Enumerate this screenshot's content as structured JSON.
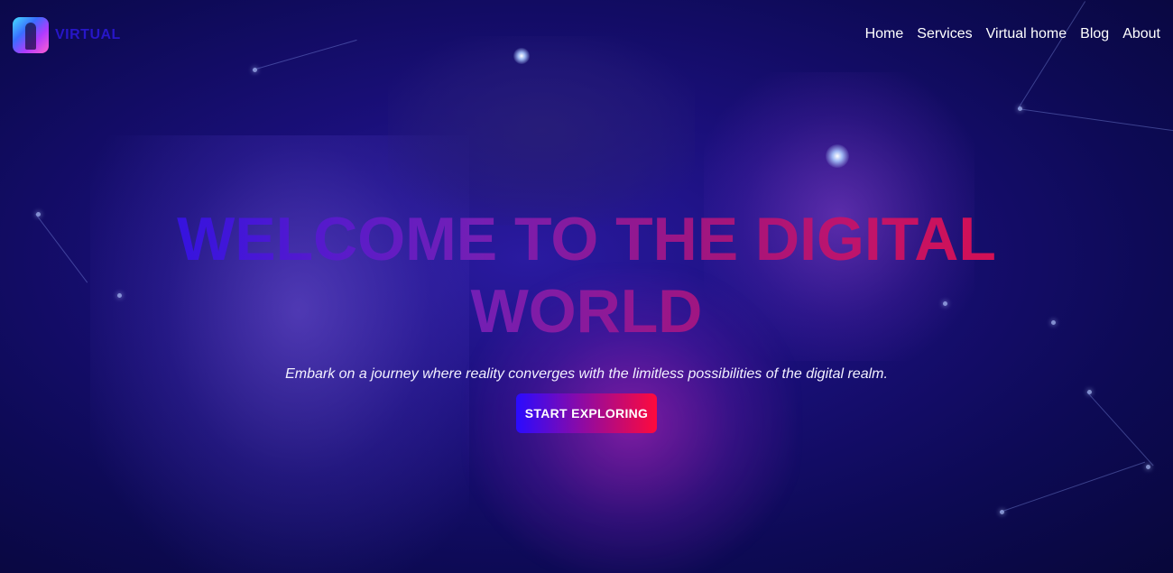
{
  "brand": {
    "logo_icon": "vr-headset-logo-icon",
    "name": "VIRTUAL"
  },
  "nav": {
    "items": [
      {
        "label": "Home"
      },
      {
        "label": "Services"
      },
      {
        "label": "Virtual home"
      },
      {
        "label": "Blog"
      },
      {
        "label": "About"
      }
    ]
  },
  "hero": {
    "title_line1": "WELCOME TO THE DIGITAL",
    "title_line2": "WORLD",
    "subtitle": "Embark on a journey where reality converges with the limitless possibilities of the digital realm.",
    "cta_label": "START EXPLORING"
  },
  "colors": {
    "brand_text": "#2716c8",
    "gradient_start": "#2a0bff",
    "gradient_end": "#ff0a3c",
    "background": "#1a0f7a"
  }
}
